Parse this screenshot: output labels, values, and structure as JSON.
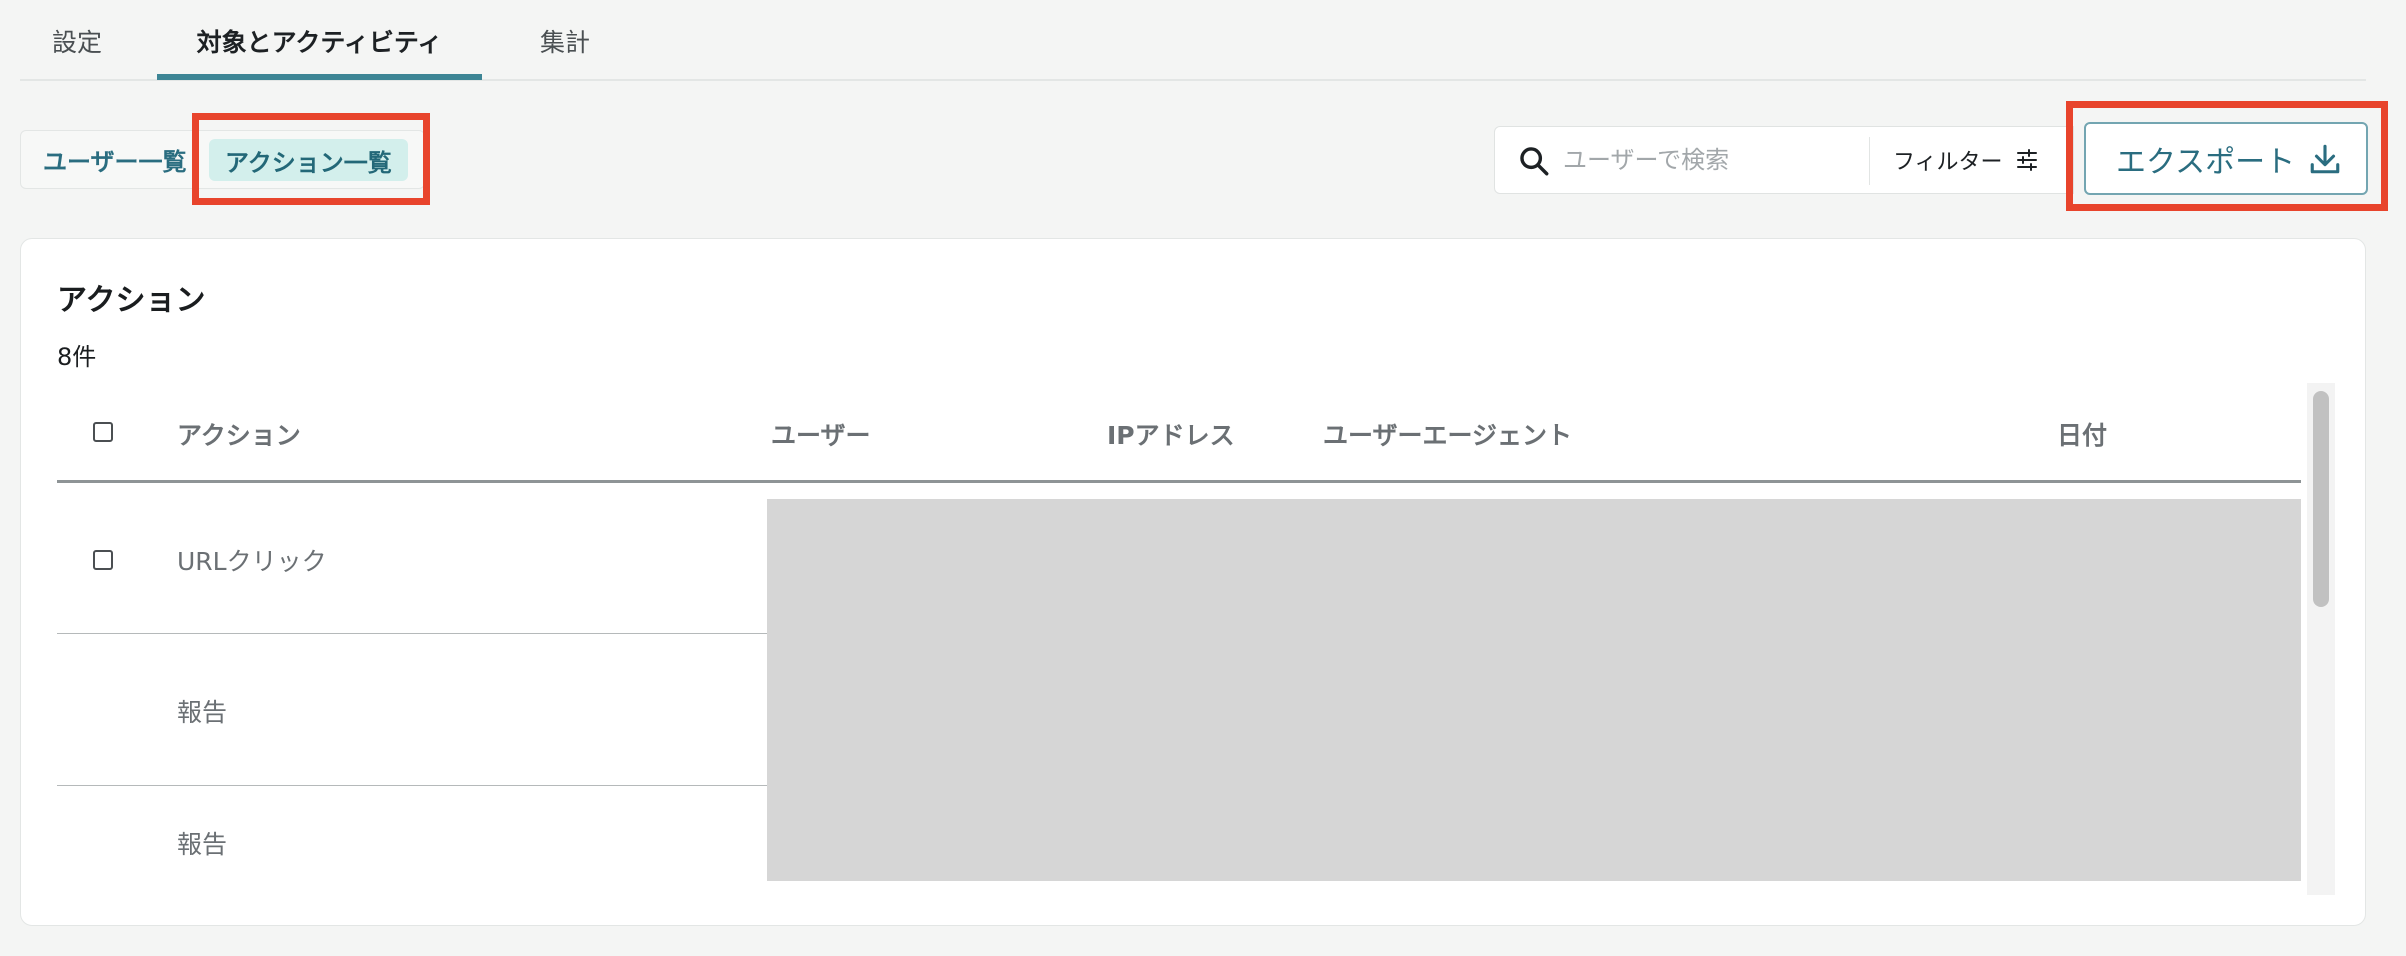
{
  "tabs": [
    {
      "label": "設定"
    },
    {
      "label": "対象とアクティビティ",
      "active": true
    },
    {
      "label": "集計"
    }
  ],
  "view_toggle": {
    "users_label": "ユーザー一覧",
    "actions_label": "アクション一覧",
    "selected": "アクション一覧"
  },
  "search": {
    "placeholder": "ユーザーで検索",
    "value": ""
  },
  "filter": {
    "label": "フィルター",
    "icon": "sliders-icon"
  },
  "export": {
    "label": "エクスポート",
    "icon": "download-icon"
  },
  "card": {
    "title": "アクション",
    "count": "8件"
  },
  "table": {
    "columns": [
      "アクション",
      "ユーザー",
      "IPアドレス",
      "ユーザーエージェント",
      "日付"
    ],
    "rows": [
      {
        "action": "URLクリック",
        "checkbox": true
      },
      {
        "action": "報告",
        "checkbox": false
      },
      {
        "action": "報告",
        "checkbox": false
      }
    ]
  },
  "colors": {
    "accent": "#2a6d80",
    "tab_underline": "#3d8595",
    "selected_bg": "#d3efec",
    "highlight": "#e8442c",
    "redaction": "#d6d6d6"
  }
}
